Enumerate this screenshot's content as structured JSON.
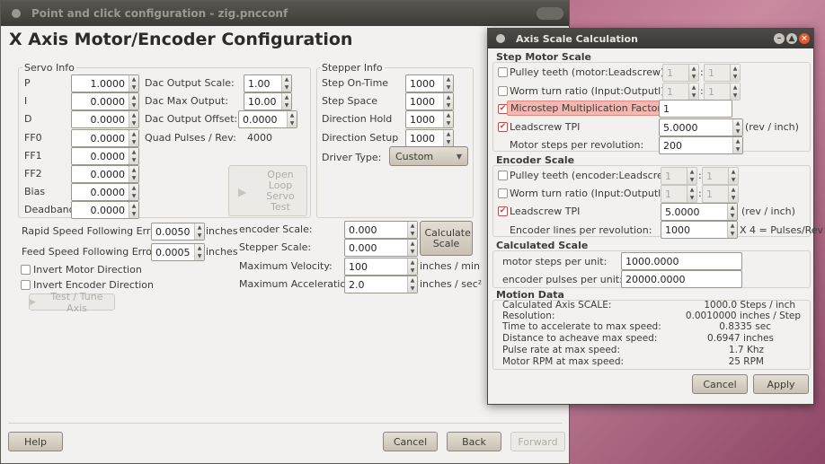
{
  "main": {
    "title": "Point and click configuration - zig.pncconf",
    "heading": "X Axis Motor/Encoder Configuration",
    "servo": {
      "title": "Servo Info",
      "fields": [
        {
          "label": "P",
          "value": "1.0000"
        },
        {
          "label": "I",
          "value": "0.0000"
        },
        {
          "label": "D",
          "value": "0.0000"
        },
        {
          "label": "FF0",
          "value": "0.0000"
        },
        {
          "label": "FF1",
          "value": "0.0000"
        },
        {
          "label": "FF2",
          "value": "0.0000"
        },
        {
          "label": "Bias",
          "value": "0.0000"
        },
        {
          "label": "Deadband",
          "value": "0.0000"
        }
      ],
      "dac_output_scale_label": "Dac Output Scale:",
      "dac_output_scale": "1.00",
      "dac_max_output_label": "Dac Max Output:",
      "dac_max_output": "10.00",
      "dac_output_offset_label": "Dac Output Offset:",
      "dac_output_offset": "0.0000",
      "quad_pulses_label": "Quad Pulses / Rev:",
      "quad_pulses": "4000"
    },
    "open_loop_test": "Open Loop Servo Test",
    "stepper": {
      "title": "Stepper Info",
      "fields": [
        {
          "label": "Step On-Time",
          "value": "1000"
        },
        {
          "label": "Step Space",
          "value": "1000"
        },
        {
          "label": "Direction Hold",
          "value": "1000"
        },
        {
          "label": "Direction Setup",
          "value": "1000"
        }
      ],
      "driver_type_label": "Driver Type:",
      "driver_type": "Custom"
    },
    "rapid_error_label": "Rapid Speed Following Error:",
    "rapid_error": "0.0050",
    "feed_error_label": "Feed Speed Following Error:",
    "feed_error": "0.0005",
    "inches": "inches",
    "invert_motor": "Invert Motor Direction",
    "invert_encoder": "Invert Encoder Direction",
    "test_tune": "Test / Tune Axis",
    "encoder_scale_label": "encoder Scale:",
    "encoder_scale": "0.000",
    "stepper_scale_label": "Stepper Scale:",
    "stepper_scale": "0.000",
    "max_velocity_label": "Maximum Velocity:",
    "max_velocity": "100",
    "max_velocity_unit": "inches / min",
    "max_accel_label": "Maximum Acceleration:",
    "max_accel": "2.0",
    "max_accel_unit": "inches / sec²",
    "calculate_scale": "Calculate Scale",
    "help": "Help",
    "cancel": "Cancel",
    "back": "Back",
    "forward": "Forward"
  },
  "dialog": {
    "title": "Axis Scale Calculation",
    "step_motor_scale": "Step Motor Scale",
    "pulley_motor_label": "Pulley teeth (motor:Leadscrew):",
    "pulley_motor_a": "1",
    "pulley_motor_b": "1",
    "worm_label": "Worm turn ratio (Input:Outputl)",
    "worm_a": "1",
    "worm_b": "1",
    "microstep_label": "Microstep Multiplication Factor:",
    "microstep": "1",
    "leadscrew_label": "Leadscrew TPI",
    "leadscrew": "5.0000",
    "rev_inch": "(rev / inch)",
    "motor_steps_label": "Motor steps per revolution:",
    "motor_steps": "200",
    "encoder_scale": "Encoder Scale",
    "pulley_enc_label": "Pulley teeth (encoder:Leadscrew):",
    "pulley_enc_a": "1",
    "pulley_enc_b": "1",
    "enc_worm_label": "Worm turn ratio (Input:Outputl)",
    "enc_worm_a": "1",
    "enc_worm_b": "1",
    "enc_leadscrew_label": "Leadscrew TPI",
    "enc_leadscrew": "5.0000",
    "enc_rev_inch": "(rev / inch)",
    "encoder_lines_label": "Encoder lines per revolution:",
    "encoder_lines": "1000",
    "x4_label": "X 4 = Pulses/Rev",
    "calculated_scale": "Calculated Scale",
    "motor_steps_unit_label": "motor steps per unit:",
    "motor_steps_unit": "1000.0000",
    "encoder_pulses_unit_label": "encoder pulses per unit:",
    "encoder_pulses_unit": "20000.0000",
    "motion_data": "Motion Data",
    "motion": [
      {
        "label": "Calculated Axis SCALE:",
        "value": "1000.0 Steps / inch"
      },
      {
        "label": "Resolution:",
        "value": "0.0010000 inches / Step"
      },
      {
        "label": "Time to accelerate to max speed:",
        "value": "0.8335 sec"
      },
      {
        "label": "Distance to acheave max speed:",
        "value": "0.6947 inches"
      },
      {
        "label": "Pulse rate at max speed:",
        "value": "1.7 Khz"
      },
      {
        "label": "Motor RPM at max speed:",
        "value": "25 RPM"
      }
    ],
    "cancel": "Cancel",
    "apply": "Apply"
  }
}
